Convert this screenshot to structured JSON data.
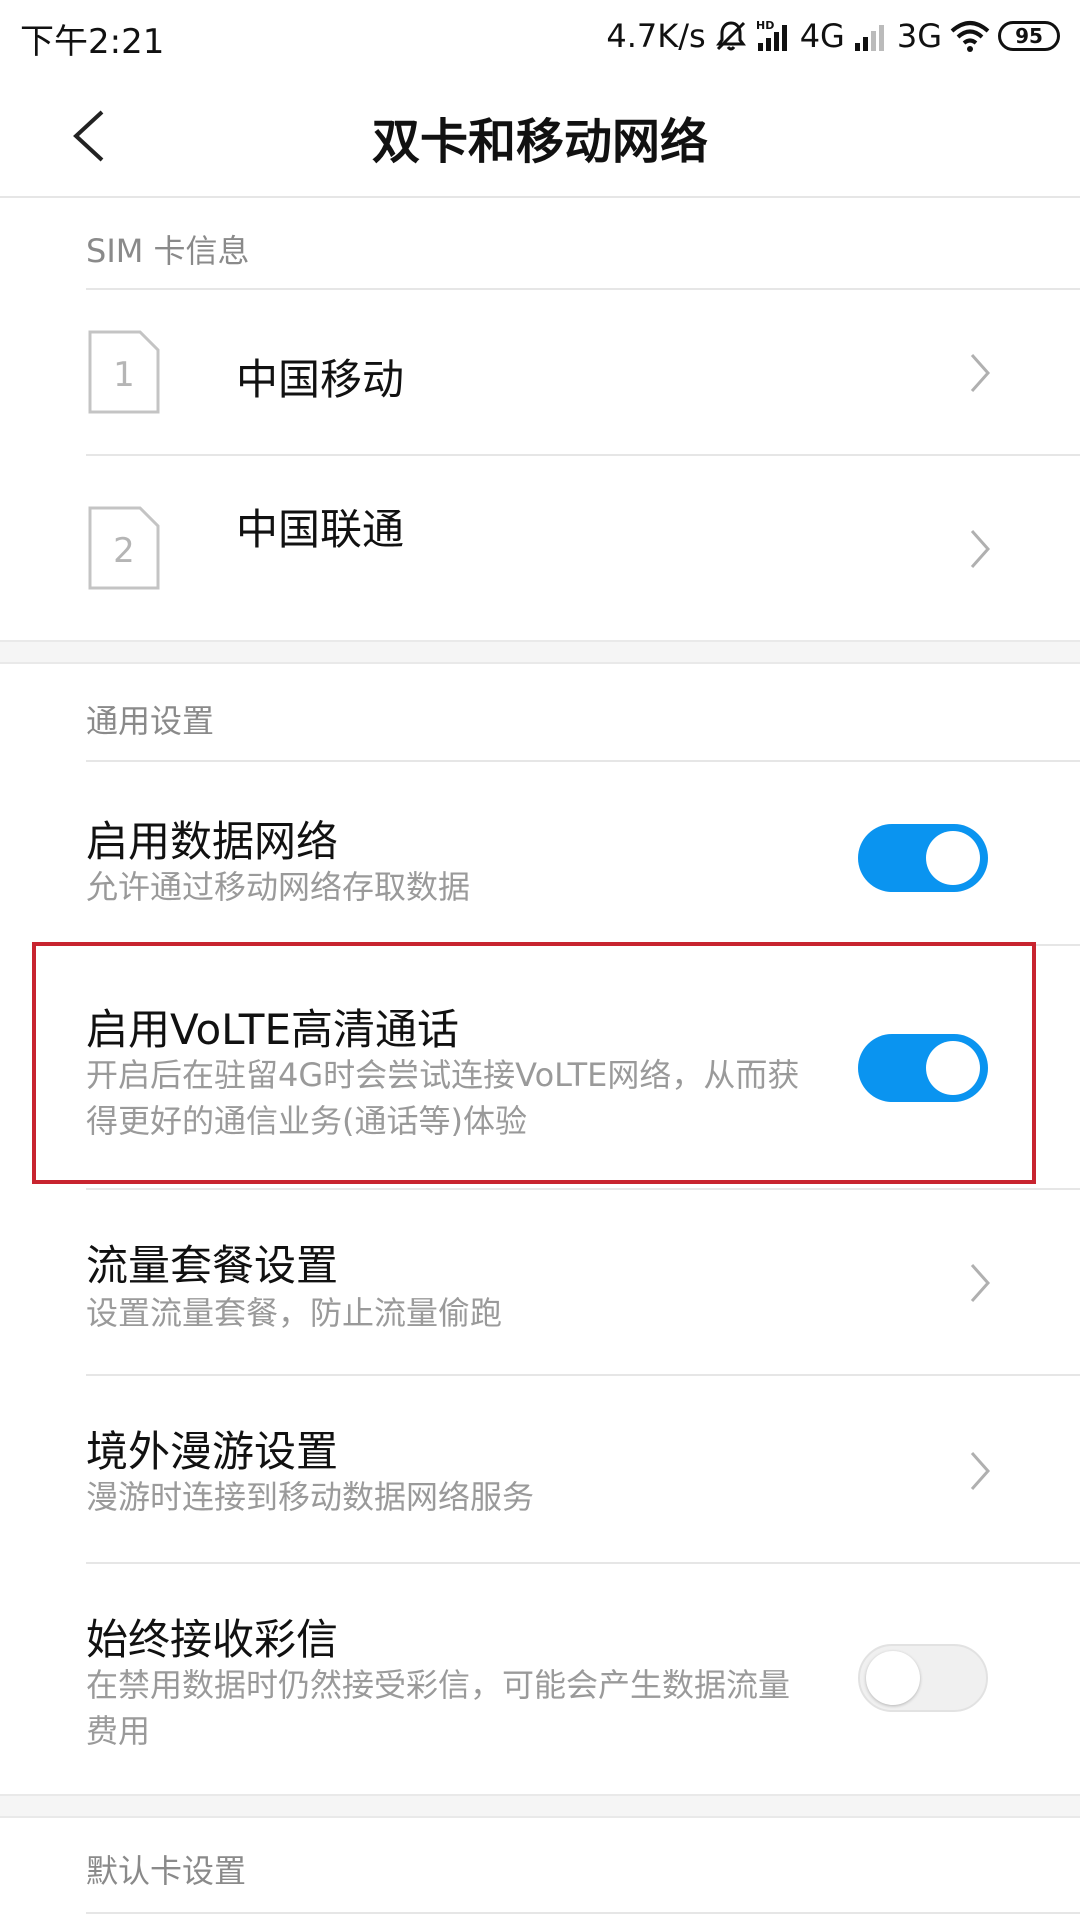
{
  "status_bar": {
    "time": "下午2:21",
    "net_speed": "4.7K/s",
    "network_1": "4G",
    "network_2": "3G",
    "battery": "95",
    "icons": [
      "mute-icon",
      "hd-signal-icon",
      "signal-icon",
      "wifi-icon",
      "battery-icon"
    ]
  },
  "header": {
    "title": "双卡和移动网络",
    "back_icon": "back-arrow-icon"
  },
  "sim_section": {
    "title": "SIM 卡信息",
    "cards": [
      {
        "slot": "1",
        "name": "中国移动"
      },
      {
        "slot": "2",
        "name": "中国联通"
      }
    ]
  },
  "general_section": {
    "title": "通用设置",
    "items": [
      {
        "title": "启用数据网络",
        "desc": "允许通过移动网络存取数据",
        "control": "toggle",
        "on": true
      },
      {
        "title": "启用VoLTE高清通话",
        "desc": "开启后在驻留4G时会尝试连接VoLTE网络，从而获得更好的通信业务(通话等)体验",
        "control": "toggle",
        "on": true,
        "highlighted": true
      },
      {
        "title": "流量套餐设置",
        "desc": "设置流量套餐，防止流量偷跑",
        "control": "chevron"
      },
      {
        "title": "境外漫游设置",
        "desc": "漫游时连接到移动数据网络服务",
        "control": "chevron"
      },
      {
        "title": "始终接收彩信",
        "desc": "在禁用数据时仍然接受彩信，可能会产生数据流量费用",
        "control": "toggle",
        "on": false
      }
    ]
  },
  "default_section": {
    "title": "默认卡设置"
  },
  "colors": {
    "accent": "#0a94f0",
    "highlight": "#c8242f",
    "secondary_text": "#9a9a9a"
  }
}
